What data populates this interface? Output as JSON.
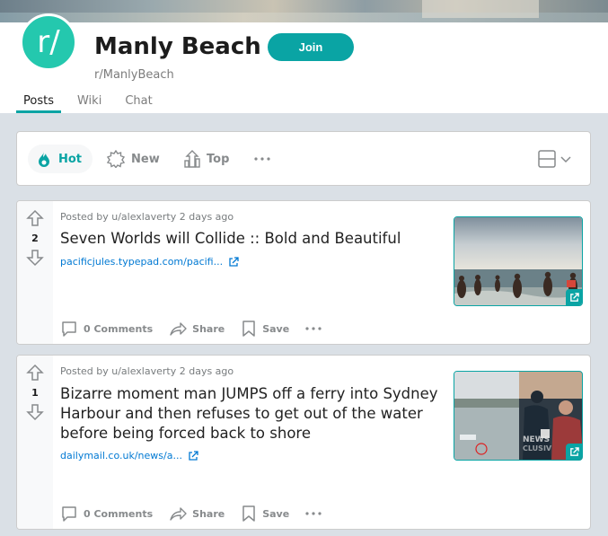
{
  "subreddit": {
    "avatar_text": "r/",
    "title": "Manly Beach",
    "name": "r/ManlyBeach",
    "join_label": "Join"
  },
  "tabs": [
    {
      "label": "Posts",
      "active": true
    },
    {
      "label": "Wiki",
      "active": false
    },
    {
      "label": "Chat",
      "active": false
    }
  ],
  "sort": {
    "hot": "Hot",
    "new": "New",
    "top": "Top",
    "more": "•••"
  },
  "posts": [
    {
      "score": "2",
      "meta": "Posted by u/alexlaverty 2 days ago",
      "title": "Seven Worlds will Collide :: Bold and Beautiful",
      "link": "pacificjules.typepad.com/pacifi...",
      "comments": "0 Comments",
      "share": "Share",
      "save": "Save"
    },
    {
      "score": "1",
      "meta": "Posted by u/alexlaverty 2 days ago",
      "title_lines": [
        "Bizarre moment man JUMPS off a ferry into Sydney",
        "Harbour and then refuses to get out of the water",
        "before being forced back to shore"
      ],
      "link": "dailymail.co.uk/news/a...",
      "comments": "0 Comments",
      "share": "Share",
      "save": "Save"
    }
  ],
  "colors": {
    "accent": "#0AA4A4",
    "avatar": "#24C8AE",
    "link": "#0079D3",
    "page_bg": "#DAE0E6"
  }
}
